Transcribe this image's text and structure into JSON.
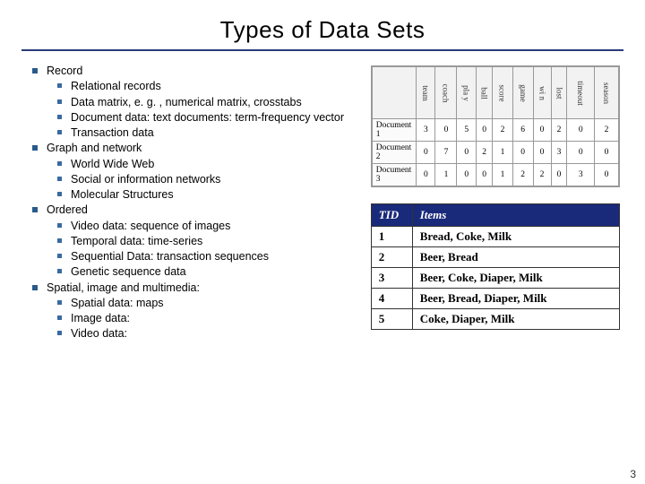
{
  "title": "Types of Data Sets",
  "outline": [
    {
      "label": "Record",
      "children": [
        "Relational records",
        "Data matrix, e. g. , numerical matrix, crosstabs",
        "Document data: text documents: term-frequency vector",
        "Transaction data"
      ]
    },
    {
      "label": "Graph and network",
      "children": [
        "World Wide Web",
        "Social or information networks",
        "Molecular Structures"
      ]
    },
    {
      "label": "Ordered",
      "children": [
        "Video data: sequence of images",
        "Temporal data: time-series",
        "Sequential Data: transaction sequences",
        "Genetic sequence data"
      ]
    },
    {
      "label": "Spatial, image and multimedia:",
      "children": [
        "Spatial data: maps",
        "Image data:",
        "Video data:"
      ]
    }
  ],
  "chart_data": {
    "type": "table",
    "title": "Document-term frequency table",
    "columns": [
      "team",
      "coach",
      "pla y",
      "ball",
      "score",
      "game",
      "wi n",
      "lost",
      "timeout",
      "season"
    ],
    "rows": [
      {
        "name": "Document 1",
        "values": [
          3,
          0,
          5,
          0,
          2,
          6,
          0,
          2,
          0,
          2
        ]
      },
      {
        "name": "Document 2",
        "values": [
          0,
          7,
          0,
          2,
          1,
          0,
          0,
          3,
          0,
          0
        ]
      },
      {
        "name": "Document 3",
        "values": [
          0,
          1,
          0,
          0,
          1,
          2,
          2,
          0,
          3,
          0
        ]
      }
    ]
  },
  "tid_table": {
    "headers": [
      "TID",
      "Items"
    ],
    "rows": [
      {
        "tid": "1",
        "items": "Bread, Coke, Milk"
      },
      {
        "tid": "2",
        "items": "Beer, Bread"
      },
      {
        "tid": "3",
        "items": "Beer, Coke, Diaper, Milk"
      },
      {
        "tid": "4",
        "items": "Beer, Bread, Diaper, Milk"
      },
      {
        "tid": "5",
        "items": "Coke, Diaper, Milk"
      }
    ]
  },
  "page_number": "3"
}
